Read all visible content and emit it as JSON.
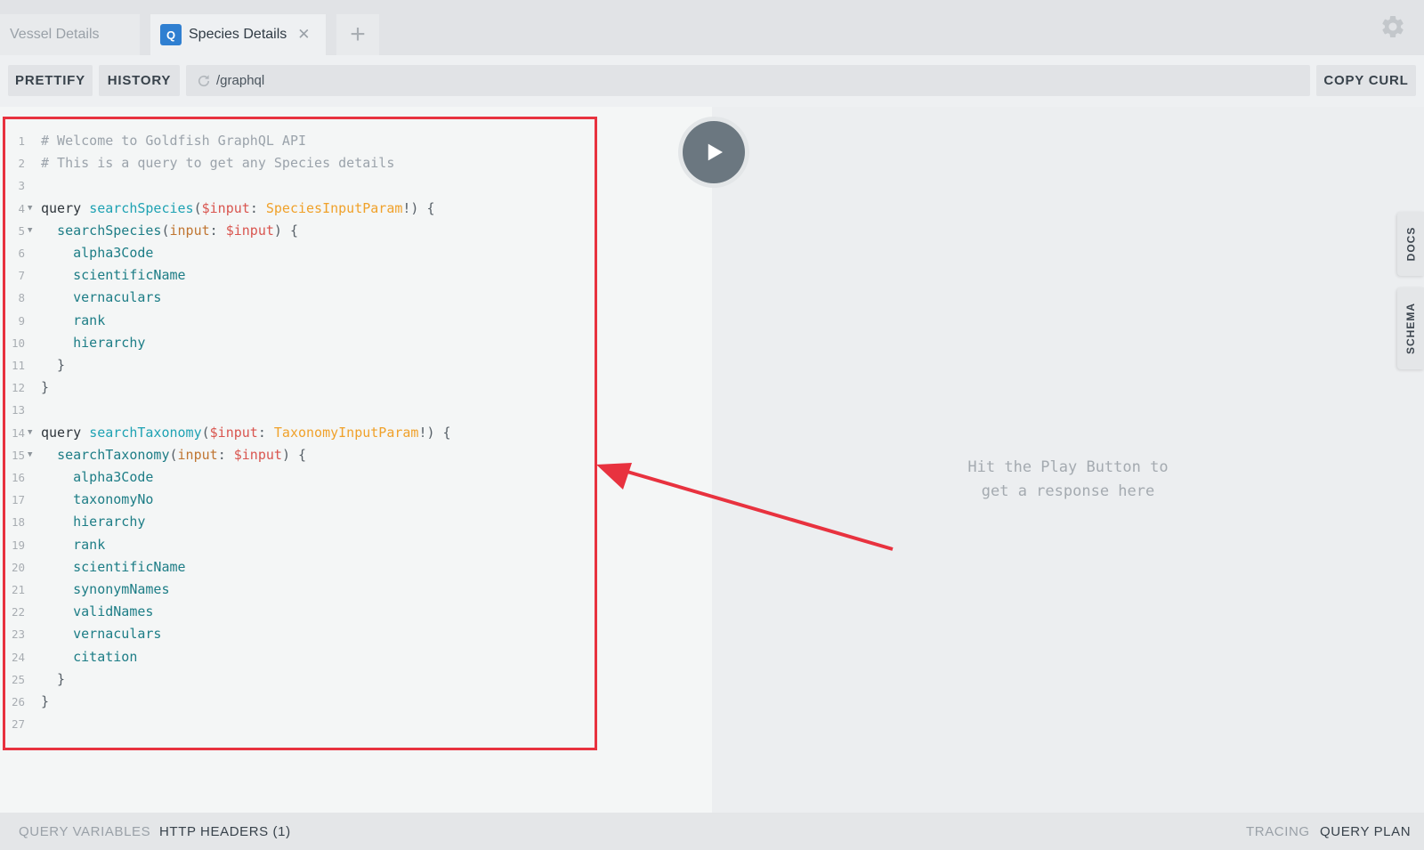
{
  "tabs": [
    {
      "label": "Vessel Details",
      "active": false
    },
    {
      "label": "Species Details",
      "active": true,
      "badge": "Q"
    }
  ],
  "icons": {
    "settings": "gear-icon",
    "add_tab": "plus-icon",
    "close_tab": "close-icon",
    "reload": "reload-icon",
    "run": "play-icon"
  },
  "toolbar": {
    "prettify_label": "PRETTIFY",
    "history_label": "HISTORY",
    "url": "/graphql",
    "copy_curl_label": "COPY CURL"
  },
  "editor": {
    "lines": [
      {
        "n": "1",
        "fold": false,
        "tokens": [
          [
            "c-comment",
            "# Welcome to Goldfish GraphQL API"
          ]
        ]
      },
      {
        "n": "2",
        "fold": false,
        "tokens": [
          [
            "c-comment",
            "# This is a query to get any Species details"
          ]
        ]
      },
      {
        "n": "3",
        "fold": false,
        "tokens": []
      },
      {
        "n": "4",
        "fold": true,
        "tokens": [
          [
            "c-kw",
            "query "
          ],
          [
            "c-def",
            "searchSpecies"
          ],
          [
            "c-punct",
            "("
          ],
          [
            "c-var",
            "$input"
          ],
          [
            "c-punct",
            ": "
          ],
          [
            "c-type",
            "SpeciesInputParam"
          ],
          [
            "c-punct",
            "!) {"
          ]
        ]
      },
      {
        "n": "5",
        "fold": true,
        "tokens": [
          [
            "c-punct",
            "  "
          ],
          [
            "c-field",
            "searchSpecies"
          ],
          [
            "c-punct",
            "("
          ],
          [
            "c-arg",
            "input"
          ],
          [
            "c-punct",
            ": "
          ],
          [
            "c-var",
            "$input"
          ],
          [
            "c-punct",
            ") {"
          ]
        ]
      },
      {
        "n": "6",
        "fold": false,
        "tokens": [
          [
            "c-field",
            "    alpha3Code"
          ]
        ]
      },
      {
        "n": "7",
        "fold": false,
        "tokens": [
          [
            "c-field",
            "    scientificName"
          ]
        ]
      },
      {
        "n": "8",
        "fold": false,
        "tokens": [
          [
            "c-field",
            "    vernaculars"
          ]
        ]
      },
      {
        "n": "9",
        "fold": false,
        "tokens": [
          [
            "c-field",
            "    rank"
          ]
        ]
      },
      {
        "n": "10",
        "fold": false,
        "tokens": [
          [
            "c-field",
            "    hierarchy"
          ]
        ]
      },
      {
        "n": "11",
        "fold": false,
        "tokens": [
          [
            "c-punct",
            "  }"
          ]
        ]
      },
      {
        "n": "12",
        "fold": false,
        "tokens": [
          [
            "c-punct",
            "}"
          ]
        ]
      },
      {
        "n": "13",
        "fold": false,
        "tokens": []
      },
      {
        "n": "14",
        "fold": true,
        "tokens": [
          [
            "c-kw",
            "query "
          ],
          [
            "c-def",
            "searchTaxonomy"
          ],
          [
            "c-punct",
            "("
          ],
          [
            "c-var",
            "$input"
          ],
          [
            "c-punct",
            ": "
          ],
          [
            "c-type",
            "TaxonomyInputParam"
          ],
          [
            "c-punct",
            "!) {"
          ]
        ]
      },
      {
        "n": "15",
        "fold": true,
        "tokens": [
          [
            "c-punct",
            "  "
          ],
          [
            "c-field",
            "searchTaxonomy"
          ],
          [
            "c-punct",
            "("
          ],
          [
            "c-arg",
            "input"
          ],
          [
            "c-punct",
            ": "
          ],
          [
            "c-var",
            "$input"
          ],
          [
            "c-punct",
            ") {"
          ]
        ]
      },
      {
        "n": "16",
        "fold": false,
        "tokens": [
          [
            "c-field",
            "    alpha3Code"
          ]
        ]
      },
      {
        "n": "17",
        "fold": false,
        "tokens": [
          [
            "c-field",
            "    taxonomyNo"
          ]
        ]
      },
      {
        "n": "18",
        "fold": false,
        "tokens": [
          [
            "c-field",
            "    hierarchy"
          ]
        ]
      },
      {
        "n": "19",
        "fold": false,
        "tokens": [
          [
            "c-field",
            "    rank"
          ]
        ]
      },
      {
        "n": "20",
        "fold": false,
        "tokens": [
          [
            "c-field",
            "    scientificName"
          ]
        ]
      },
      {
        "n": "21",
        "fold": false,
        "tokens": [
          [
            "c-field",
            "    synonymNames"
          ]
        ]
      },
      {
        "n": "22",
        "fold": false,
        "tokens": [
          [
            "c-field",
            "    validNames"
          ]
        ]
      },
      {
        "n": "23",
        "fold": false,
        "tokens": [
          [
            "c-field",
            "    vernaculars"
          ]
        ]
      },
      {
        "n": "24",
        "fold": false,
        "tokens": [
          [
            "c-field",
            "    citation"
          ]
        ]
      },
      {
        "n": "25",
        "fold": false,
        "tokens": [
          [
            "c-punct",
            "  }"
          ]
        ]
      },
      {
        "n": "26",
        "fold": false,
        "tokens": [
          [
            "c-punct",
            "}"
          ]
        ]
      },
      {
        "n": "27",
        "fold": false,
        "tokens": []
      }
    ]
  },
  "results": {
    "hint_line1": "Hit the Play Button to",
    "hint_line2": "get a response here"
  },
  "side_tabs": {
    "docs": "DOCS",
    "schema": "SCHEMA"
  },
  "bottom": {
    "query_variables": "QUERY VARIABLES",
    "http_headers": "HTTP HEADERS (1)",
    "tracing": "TRACING",
    "query_plan": "QUERY PLAN"
  },
  "colors": {
    "annotation_red": "#e8323f",
    "tab_badge": "#2f7fd1",
    "play_button": "#6b7780"
  }
}
